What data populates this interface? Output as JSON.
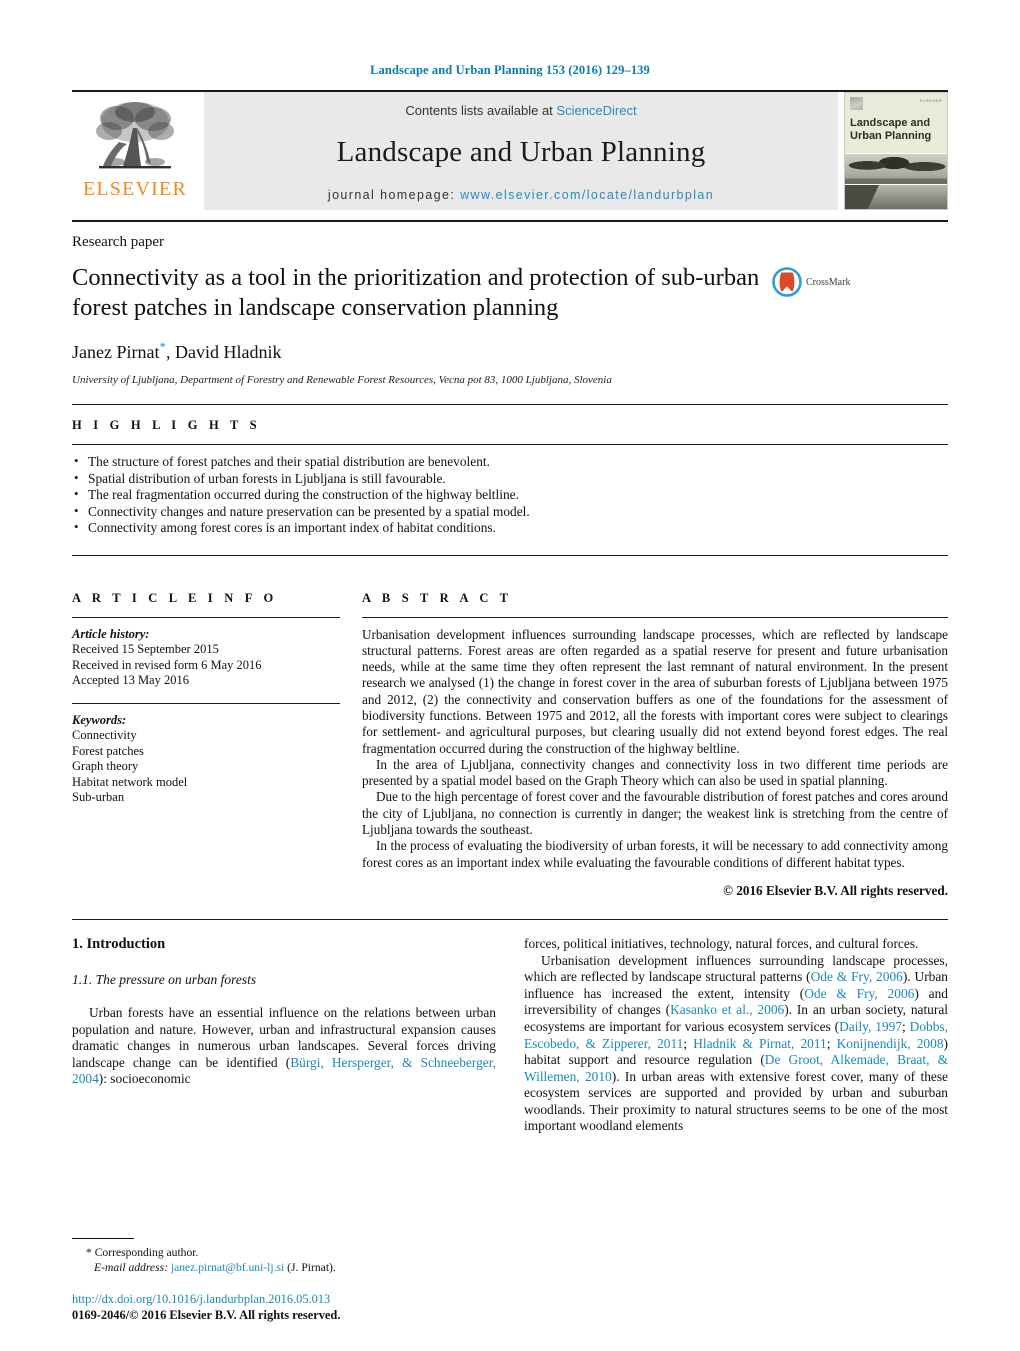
{
  "running_head": "Landscape and Urban Planning 153 (2016) 129–139",
  "masthead": {
    "publisher_name": "ELSEVIER",
    "contents_prefix": "Contents lists available at ",
    "contents_link": "ScienceDirect",
    "journal_title": "Landscape and Urban Planning",
    "homepage_prefix": "journal homepage: ",
    "homepage_url": "www.elsevier.com/locate/landurbplan",
    "cover_title": "Landscape and\nUrban Planning",
    "cover_brandmark": "ELSEVIER"
  },
  "article": {
    "type": "Research paper",
    "title": "Connectivity as a tool in the prioritization and protection of sub-urban forest patches in landscape conservation planning",
    "authors": "Janez Pirnat",
    "author_star": "*",
    "authors_rest": ", David Hladnik",
    "affiliation": "University of Ljubljana, Department of Forestry and Renewable Forest Resources, Vecna pot 83, 1000 Ljubljana, Slovenia",
    "crossmark_label": "CrossMark"
  },
  "highlights": {
    "heading": "H I G H L I G H T S",
    "items": [
      "The structure of forest patches and their spatial distribution are benevolent.",
      "Spatial distribution of urban forests in Ljubljana is still favourable.",
      "The real fragmentation occurred during the construction of the highway beltline.",
      "Connectivity changes and nature preservation can be presented by a spatial model.",
      "Connectivity among forest cores is an important index of habitat conditions."
    ]
  },
  "article_info": {
    "heading": "A R T I C L E    I N F O",
    "history_label": "Article history:",
    "history": [
      "Received 15 September 2015",
      "Received in revised form 6 May 2016",
      "Accepted 13 May 2016"
    ],
    "keywords_label": "Keywords:",
    "keywords": [
      "Connectivity",
      "Forest patches",
      "Graph theory",
      "Habitat network model",
      "Sub-urban"
    ]
  },
  "abstract": {
    "heading": "A B S T R A C T",
    "paragraphs": [
      "Urbanisation development influences surrounding landscape processes, which are reflected by landscape structural patterns. Forest areas are often regarded as a spatial reserve for present and future urbanisation needs, while at the same time they often represent the last remnant of natural environment. In the present research we analysed (1) the change in forest cover in the area of suburban forests of Ljubljana between 1975 and 2012, (2) the connectivity and conservation buffers as one of the foundations for the assessment of biodiversity functions. Between 1975 and 2012, all the forests with important cores were subject to clearings for settlement- and agricultural purposes, but clearing usually did not extend beyond forest edges. The real fragmentation occurred during the construction of the highway beltline.",
      "In the area of Ljubljana, connectivity changes and connectivity loss in two different time periods are presented by a spatial model based on the Graph Theory which can also be used in spatial planning.",
      "Due to the high percentage of forest cover and the favourable distribution of forest patches and cores around the city of Ljubljana, no connection is currently in danger; the weakest link is stretching from the centre of Ljubljana towards the southeast.",
      "In the process of evaluating the biodiversity of urban forests, it will be necessary to add connectivity among forest cores as an important index while evaluating the favourable conditions of different habitat types."
    ],
    "copyright": "© 2016 Elsevier B.V. All rights reserved."
  },
  "body": {
    "section_number_title": "1.  Introduction",
    "subsection_title": "1.1.  The pressure on urban forests",
    "left_paragraph_1_a": "Urban forests have an essential influence on the relations between urban population and nature. However, urban and infrastructural expansion causes dramatic changes in numerous urban landscapes. Several forces driving landscape change can be identified (",
    "left_cite_1": "Bürgi, Hersperger, & Schneeberger, 2004",
    "left_paragraph_1_b": "): socioeconomic",
    "right_paragraph_1": "forces, political initiatives, technology, natural forces, and cultural forces.",
    "right_paragraph_2_a": "Urbanisation development influences surrounding landscape processes, which are reflected by landscape structural patterns (",
    "right_cite_1": "Ode & Fry, 2006",
    "right_paragraph_2_b": "). Urban influence has increased the extent, intensity (",
    "right_cite_2": "Ode & Fry, 2006",
    "right_paragraph_2_c": ") and irreversibility of changes (",
    "right_cite_3": "Kasanko et al., 2006",
    "right_paragraph_2_d": "). In an urban society, natural ecosystems are important for various ecosystem services (",
    "right_cite_4": "Daily, 1997",
    "right_sep_1": "; ",
    "right_cite_5": "Dobbs, Escobedo, & Zipperer, 2011",
    "right_sep_2": "; ",
    "right_cite_6": "Hladnik & Pirnat, 2011",
    "right_sep_3": "; ",
    "right_cite_7": "Konijnendijk, 2008",
    "right_paragraph_2_e": ") habitat support and resource regulation (",
    "right_cite_8": "De Groot, Alkemade, Braat, & Willemen, 2010",
    "right_paragraph_2_f": "). In urban areas with extensive forest cover, many of these ecosystem services are supported and provided by urban and suburban woodlands. Their proximity to natural structures seems to be one of the most important woodland elements"
  },
  "footnote": {
    "corresponding_marker": "*",
    "corresponding_text": "Corresponding author.",
    "email_label": "E-mail address:",
    "email": "janez.pirnat@bf.uni-lj.si",
    "email_suffix": "(J. Pirnat)."
  },
  "bottom": {
    "doi": "http://dx.doi.org/10.1016/j.landurbplan.2016.05.013",
    "issn_line": "0169-2046/© 2016 Elsevier B.V. All rights reserved."
  },
  "colors": {
    "link": "#1a8ab5",
    "header_blue": "#0b7ba8",
    "elsevier_orange": "#f08a1d",
    "banner_grey": "#e9e9e9",
    "cover_green": "#e6ecd8"
  }
}
